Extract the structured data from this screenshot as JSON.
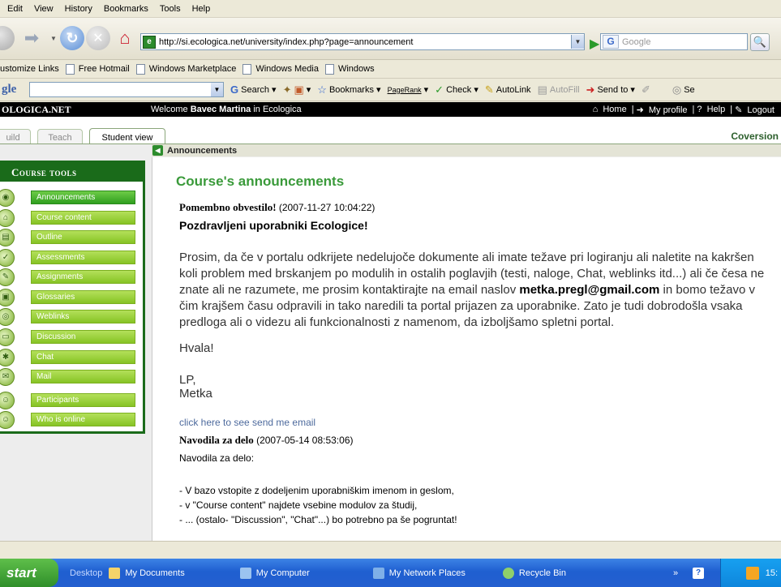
{
  "menu": [
    "Edit",
    "View",
    "History",
    "Bookmarks",
    "Tools",
    "Help"
  ],
  "address": {
    "url": "http://si.ecologica.net/university/index.php?page=announcement",
    "search_placeholder": "Google"
  },
  "links_bar": [
    "ustomize Links",
    "Free Hotmail",
    "Windows Marketplace",
    "Windows Media",
    "Windows"
  ],
  "google_bar": {
    "logo": "gle",
    "items": [
      "Search",
      "Bookmarks",
      "PageRank",
      "Check",
      "AutoLink",
      "AutoFill",
      "Send to",
      "Se"
    ]
  },
  "site_header": {
    "brand": "OLOGICA.NET",
    "welcome_prefix": "Welcome ",
    "user": "Bavec Martina",
    "welcome_suffix": " in Ecologica",
    "links": [
      "Home",
      "My profile",
      "Help",
      "Logout"
    ]
  },
  "tabs": [
    "uild",
    "Teach",
    "Student view"
  ],
  "conversion": "Coversion",
  "breadcrumb": "Announcements",
  "sidebar": {
    "title": "Course tools",
    "items": [
      "Announcements",
      "Course content",
      "Outline",
      "Assessments",
      "Assignments",
      "Glossaries",
      "Weblinks",
      "Discussion",
      "Chat",
      "Mail",
      "Participants",
      "Who is online"
    ]
  },
  "main": {
    "title": "Course's announcements",
    "ann1_title": "Pomembno obvestilo!",
    "ann1_date": " (2007-11-27 10:04:22)",
    "greeting": "Pozdravljeni uporabniki Ecologice!",
    "body_pre": "Prosim, da če v portalu odkrijete nedelujoče dokumente ali imate težave pri logiranju ali naletite na kakršen koli problem med brskanjem po modulih in ostalih poglavjih (testi, naloge, Chat, weblinks itd...) ali če česa ne znate ali ne razumete, me prosim kontaktirajte na email naslov ",
    "email": "metka.pregl@gmail.com",
    "body_post": " in bomo težavo v čim krajšem času odpravili in tako naredili ta portal prijazen za uporabnike. Zato je tudi dobrodošla vsaka predloga ali o videzu ali funkcionalnosti z namenom, da izboljšamo spletni portal.",
    "thanks": "Hvala!",
    "sign1": "LP,",
    "sign2": "Metka",
    "email_link": "click here to see send me email",
    "ann2_title": "Navodila za delo",
    "ann2_date": " (2007-05-14 08:53:06)",
    "ann2_intro": "Navodila za delo:",
    "ann2_lines": [
      "- V bazo vstopite z dodeljenim uporabniškim imenom in  geslom,",
      "- v \"Course content\" najdete vsebine modulov za študij,",
      "- ... (ostalo- \"Discussion\", \"Chat\"...) bo potrebno pa še pogruntat!"
    ]
  },
  "taskbar": {
    "start": "start",
    "items": [
      "Desktop",
      "My Documents",
      "My Computer",
      "My Network Places",
      "Recycle Bin"
    ],
    "clock": "15:"
  }
}
